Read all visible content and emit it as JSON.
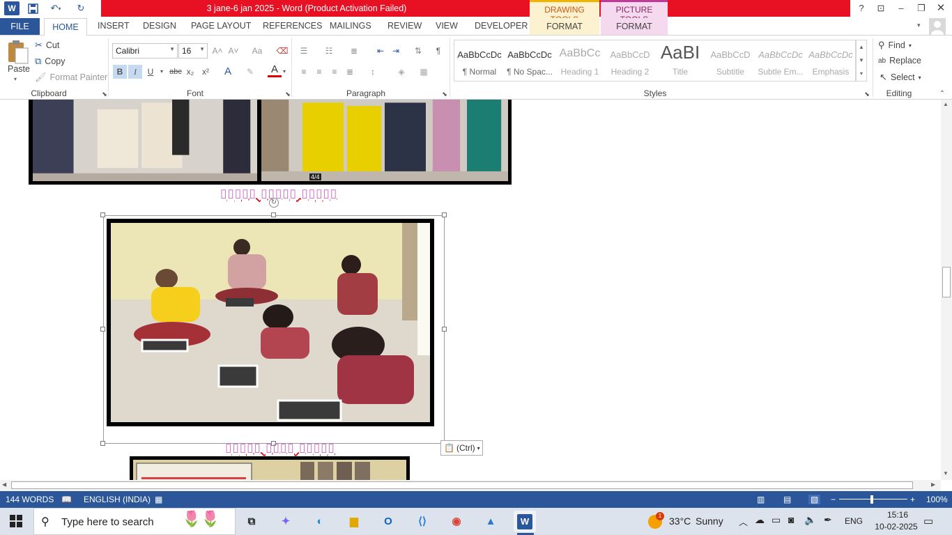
{
  "titlebar": {
    "title": "3 jane-6 jan 2025 -  Word (Product Activation Failed)",
    "drawing_tools": "DRAWING TOOLS",
    "picture_tools": "PICTURE TOOLS",
    "help": "?"
  },
  "tabs": {
    "file": "FILE",
    "home": "HOME",
    "insert": "INSERT",
    "design": "DESIGN",
    "page_layout": "PAGE LAYOUT",
    "references": "REFERENCES",
    "mailings": "MAILINGS",
    "review": "REVIEW",
    "view": "VIEW",
    "developer": "DEVELOPER",
    "format_drawing": "FORMAT",
    "format_picture": "FORMAT"
  },
  "clipboard": {
    "paste": "Paste",
    "cut": "Cut",
    "copy": "Copy",
    "format_painter": "Format Painter",
    "label": "Clipboard"
  },
  "font": {
    "name": "Calibri",
    "size": "16",
    "label": "Font",
    "bold": "B",
    "italic": "I",
    "underline": "U",
    "strike": "abc",
    "subscript": "x₂",
    "superscript": "x²",
    "grow": "A˄",
    "shrink": "A˅",
    "case": "Aa",
    "font_color": "#e00000",
    "highlight_color": "#ffff00"
  },
  "paragraph": {
    "label": "Paragraph"
  },
  "styles": {
    "label": "Styles",
    "items": [
      {
        "preview": "AaBbCcDc",
        "name": "¶ Normal"
      },
      {
        "preview": "AaBbCcDc",
        "name": "¶ No Spac..."
      },
      {
        "preview": "AaBbCc",
        "name": "Heading 1"
      },
      {
        "preview": "AaBbCcD",
        "name": "Heading 2"
      },
      {
        "preview": "AaBI",
        "name": "Title"
      },
      {
        "preview": "AaBbCcD",
        "name": "Subtitle"
      },
      {
        "preview": "AaBbCcDc",
        "name": "Subtle Em..."
      },
      {
        "preview": "AaBbCcDc",
        "name": "Emphasis"
      }
    ]
  },
  "editing": {
    "find": "Find",
    "replace": "Replace",
    "select": "Select",
    "label": "Editing"
  },
  "document": {
    "caption1": "▯▯▯▯▯ ▯▯▯▯▯ ▯▯▯▯▯",
    "caption2": "▯▯▯▯▯ ▯▯▯▯ ▯▯▯▯▯",
    "paste_options": "(Ctrl)",
    "photo_badge": "4/4"
  },
  "status": {
    "words": "144 WORDS",
    "language": "ENGLISH (INDIA)",
    "zoom": "100%"
  },
  "taskbar": {
    "search_placeholder": "Type here to search",
    "weather_temp": "33°C",
    "weather_desc": "Sunny",
    "weather_badge": "1",
    "language": "ENG",
    "time": "15:16",
    "date": "10-02-2025"
  }
}
